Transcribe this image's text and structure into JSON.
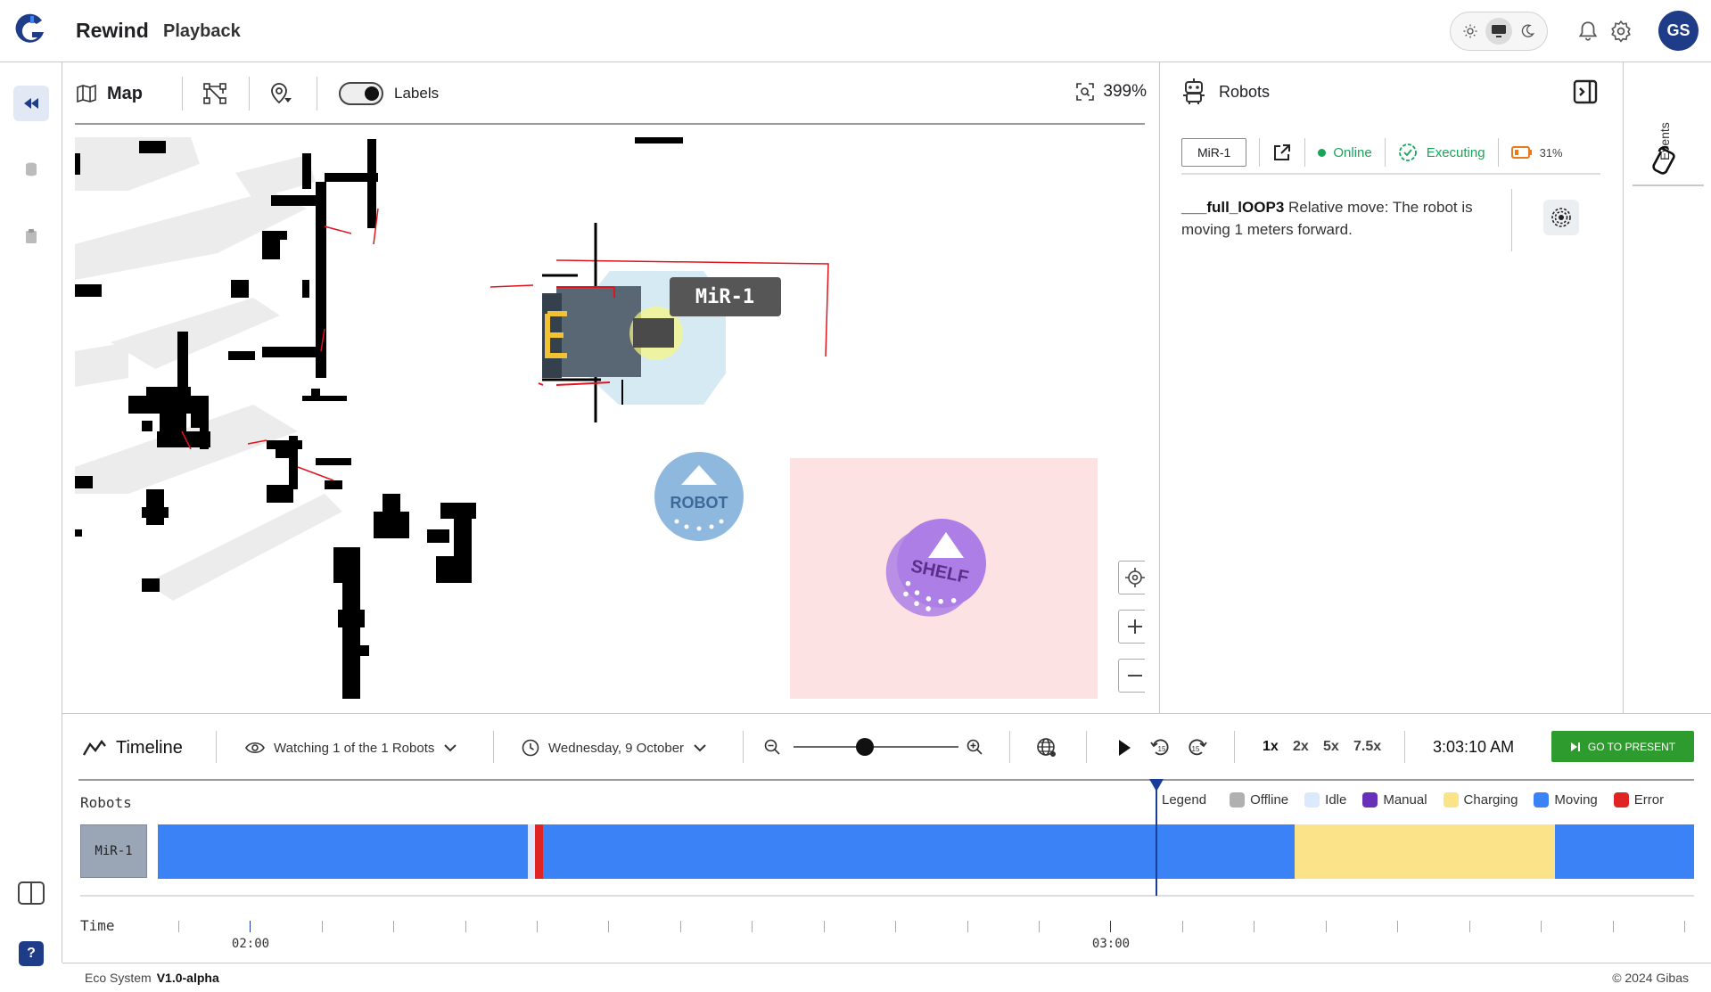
{
  "app": {
    "title": "Rewind",
    "subtitle": "Playback",
    "user_initials": "GS"
  },
  "map_toolbar": {
    "map_label": "Map",
    "labels_label": "Labels",
    "labels_on": true,
    "zoom": "399%"
  },
  "map": {
    "robot_tag": "MiR-1",
    "robot_icon_label": "ROBOT",
    "shelf_icon_label": "SHELF"
  },
  "right_panel": {
    "title": "Robots",
    "robot_name": "MiR-1",
    "status": "Online",
    "state": "Executing",
    "battery": "31%",
    "task_name": "___full_lOOP3",
    "task_desc": "Relative move: The robot is moving 1 meters forward."
  },
  "far_rail": {
    "events_label": "Events"
  },
  "timeline": {
    "title": "Timeline",
    "watching": "Watching 1 of the 1 Robots",
    "date": "Wednesday, 9 October",
    "zoom_value": 0.43,
    "speeds": [
      "1x",
      "2x",
      "5x",
      "7.5x"
    ],
    "active_speed": "1x",
    "clock": "3:03:10 AM",
    "present_label": "GO TO PRESENT",
    "robots_label": "Robots",
    "time_label": "Time",
    "legend_title": "Legend",
    "legend": [
      {
        "label": "Offline",
        "color": "#b0b0b0"
      },
      {
        "label": "Idle",
        "color": "#dce8fb"
      },
      {
        "label": "Manual",
        "color": "#6a2fb8"
      },
      {
        "label": "Charging",
        "color": "#fbe38a"
      },
      {
        "label": "Moving",
        "color": "#3b82f6"
      },
      {
        "label": "Error",
        "color": "#e02424"
      }
    ],
    "track_robot": "MiR-1",
    "tick_labels": [
      "02:00",
      "03:00"
    ]
  },
  "footer": {
    "system": "Eco System",
    "version": "V1.0-alpha",
    "copyright": "© 2024 Gibas"
  }
}
